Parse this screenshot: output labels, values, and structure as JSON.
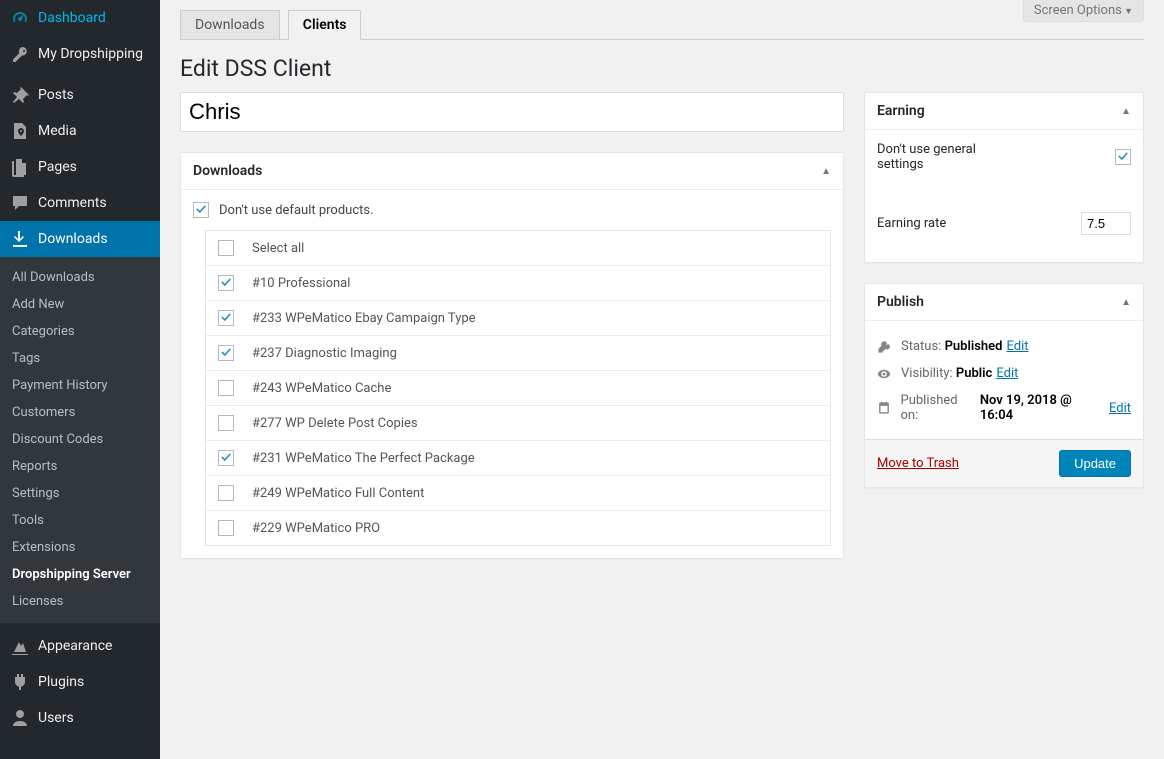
{
  "screenOptions": "Screen Options",
  "sidebar": {
    "main": [
      {
        "icon": "dashboard",
        "label": "Dashboard"
      },
      {
        "icon": "key",
        "label": "My Dropshipping"
      }
    ],
    "content": [
      {
        "icon": "pin",
        "label": "Posts"
      },
      {
        "icon": "media",
        "label": "Media"
      },
      {
        "icon": "page",
        "label": "Pages"
      },
      {
        "icon": "comment",
        "label": "Comments"
      },
      {
        "icon": "download",
        "label": "Downloads",
        "current": true
      }
    ],
    "submenu": [
      {
        "label": "All Downloads"
      },
      {
        "label": "Add New"
      },
      {
        "label": "Categories"
      },
      {
        "label": "Tags"
      },
      {
        "label": "Payment History"
      },
      {
        "label": "Customers"
      },
      {
        "label": "Discount Codes"
      },
      {
        "label": "Reports"
      },
      {
        "label": "Settings"
      },
      {
        "label": "Tools"
      },
      {
        "label": "Extensions"
      },
      {
        "label": "Dropshipping Server",
        "current": true
      },
      {
        "label": "Licenses"
      }
    ],
    "bottom": [
      {
        "icon": "appearance",
        "label": "Appearance"
      },
      {
        "icon": "plugin",
        "label": "Plugins"
      },
      {
        "icon": "user",
        "label": "Users"
      }
    ]
  },
  "tabs": [
    {
      "label": "Downloads",
      "active": false
    },
    {
      "label": "Clients",
      "active": true
    }
  ],
  "pageTitle": "Edit DSS Client",
  "titleValue": "Chris",
  "downloadsBox": {
    "title": "Downloads",
    "dontUseDefault": {
      "checked": true,
      "label": "Don't use default products."
    },
    "selectAll": "Select all",
    "products": [
      {
        "checked": true,
        "label": "#10 Professional"
      },
      {
        "checked": true,
        "label": "#233 WPeMatico Ebay Campaign Type"
      },
      {
        "checked": true,
        "label": "#237 Diagnostic Imaging"
      },
      {
        "checked": false,
        "label": "#243 WPeMatico Cache"
      },
      {
        "checked": false,
        "label": "#277 WP Delete Post Copies"
      },
      {
        "checked": true,
        "label": "#231 WPeMatico The Perfect Package"
      },
      {
        "checked": false,
        "label": "#249 WPeMatico Full Content"
      },
      {
        "checked": false,
        "label": "#229 WPeMatico PRO"
      }
    ]
  },
  "earningBox": {
    "title": "Earning",
    "dontUseGeneral": {
      "checked": true,
      "label": "Don't use general settings"
    },
    "rateLabel": "Earning rate",
    "rateValue": "7.5"
  },
  "publishBox": {
    "title": "Publish",
    "statusLabel": "Status:",
    "statusValue": "Published",
    "visibilityLabel": "Visibility:",
    "visibilityValue": "Public",
    "publishedLabel": "Published on:",
    "publishedValue": "Nov 19, 2018 @ 16:04",
    "editText": "Edit",
    "trashText": "Move to Trash",
    "updateText": "Update"
  }
}
